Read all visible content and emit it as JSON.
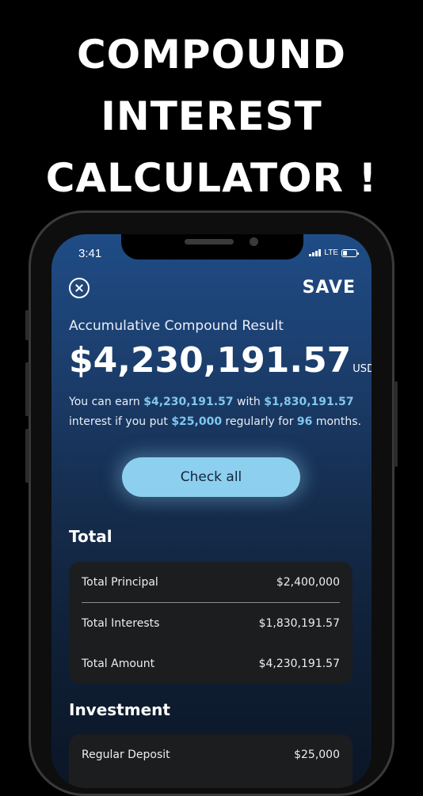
{
  "headline": [
    "COMPOUND",
    "INTEREST",
    "CALCULATOR !"
  ],
  "status": {
    "time": "3:41",
    "network": "LTE"
  },
  "header": {
    "save_label": "SAVE"
  },
  "result": {
    "label": "Accumulative Compound Result",
    "value": "$4,230,191.57",
    "unit": "USD",
    "summary": {
      "p1": "You can earn",
      "amount": "$4,230,191.57",
      "p2": "with",
      "interest": "$1,830,191.57",
      "p3": "interest if you put",
      "deposit": "$25,000",
      "p4": "regularly for",
      "months": "96",
      "p5": "months."
    }
  },
  "check_all_label": "Check all",
  "total": {
    "title": "Total",
    "rows": [
      {
        "label": "Total Principal",
        "value": "$2,400,000"
      },
      {
        "label": "Total Interests",
        "value": "$1,830,191.57"
      },
      {
        "label": "Total Amount",
        "value": "$4,230,191.57"
      }
    ]
  },
  "investment": {
    "title": "Investment",
    "rows": [
      {
        "label": "Regular Deposit",
        "value": "$25,000"
      }
    ]
  }
}
